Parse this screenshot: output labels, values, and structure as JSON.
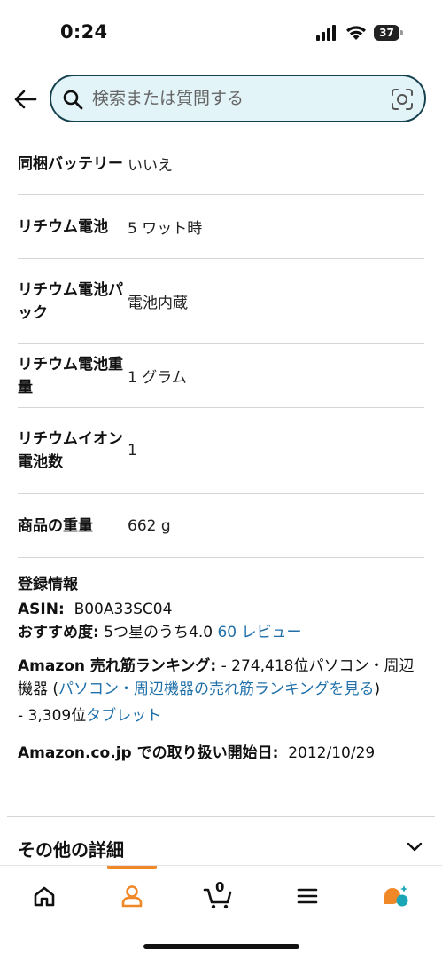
{
  "status_bar": {
    "time": "0:24",
    "battery": "37"
  },
  "search": {
    "placeholder": "検索または質問する"
  },
  "specs": [
    {
      "label": "同梱バッテリー",
      "value": "いいえ"
    },
    {
      "label": "リチウム電池",
      "value": "5 ワット時"
    },
    {
      "label": "リチウム電池パック",
      "value": "電池内蔵"
    },
    {
      "label": "リチウム電池重量",
      "value": "1 グラム"
    },
    {
      "label": "リチウムイオン電池数",
      "value": "1"
    },
    {
      "label": "商品の重量",
      "value": "662 g"
    }
  ],
  "registration": {
    "title": "登録情報",
    "asin_label": "ASIN:",
    "asin_value": "B00A33SC04",
    "rating_label": "おすすめ度:",
    "rating_value": "5つ星のうち4.0",
    "reviews_link": "60 レビュー",
    "ranking_label": "Amazon 売れ筋ランキング:",
    "ranking_text_1": "- 274,418位パソコン・周辺機器 (",
    "ranking_link_1": "パソコン・周辺機器の売れ筋ランキングを見る",
    "ranking_text_2": ")",
    "ranking_sub_prefix": "- 3,309位",
    "ranking_sub_link": "タブレット",
    "release_label": "Amazon.co.jp での取り扱い開始日:",
    "release_value": "2012/10/29"
  },
  "more_details": {
    "label": "その他の詳細"
  },
  "bottom_nav": {
    "cart_count": "0",
    "accent_color": "#f08828",
    "items": [
      "home-icon",
      "account-icon",
      "cart-icon",
      "menu-icon",
      "chat-assistant-icon"
    ]
  }
}
